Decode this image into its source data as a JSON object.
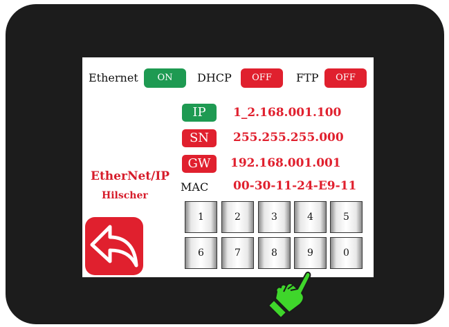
{
  "header": {
    "ethernet_label": "Ethernet",
    "ethernet_state": "ON",
    "dhcp_label": "DHCP",
    "dhcp_state": "OFF",
    "ftp_label": "FTP",
    "ftp_state": "OFF"
  },
  "network": {
    "ip_tag": "IP",
    "ip_value": "1_2.168.001.100",
    "sn_tag": "SN",
    "sn_value": "255.255.255.000",
    "gw_tag": "GW",
    "gw_value": "192.168.001.001",
    "mac_label": "MAC",
    "mac_value": "00-30-11-24-E9-11"
  },
  "brand": {
    "protocol": "EtherNet/IP",
    "vendor": "Hilscher"
  },
  "keypad": {
    "row1": [
      "1",
      "2",
      "3",
      "4",
      "5"
    ],
    "row2": [
      "6",
      "7",
      "8",
      "9",
      "0"
    ]
  },
  "colors": {
    "on": "#1e9a52",
    "off": "#e0202e",
    "pointer": "#3fd62b"
  },
  "icons": {
    "back": "back-arrow-icon",
    "pointer": "pointing-hand-icon"
  }
}
